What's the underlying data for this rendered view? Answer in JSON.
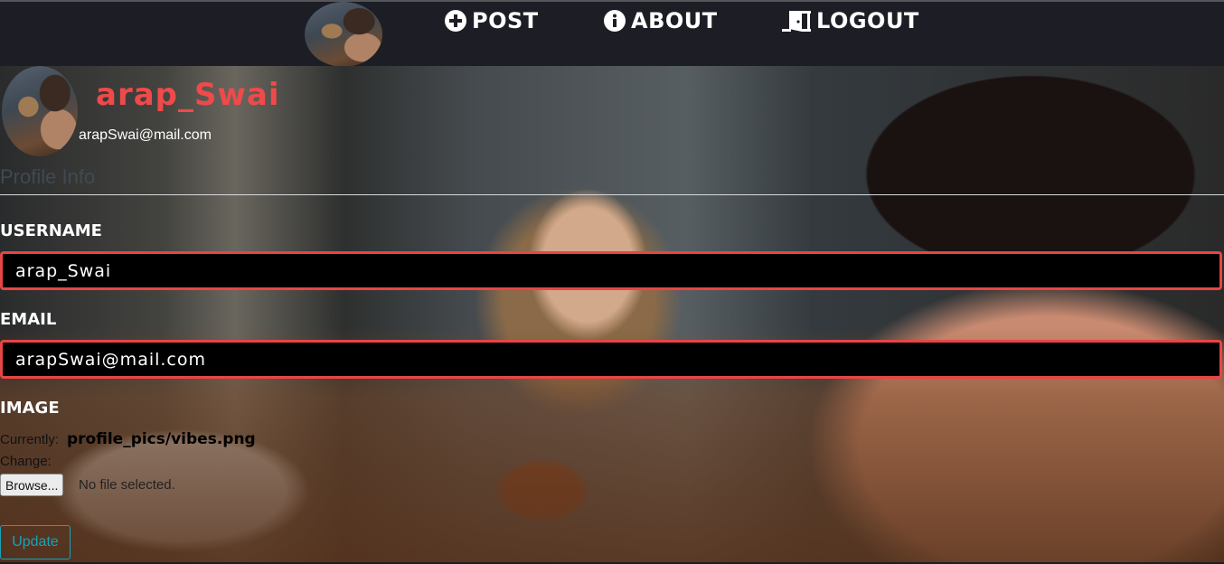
{
  "nav": {
    "post_label": "POST",
    "about_label": "ABOUT",
    "logout_label": "LOGOUT"
  },
  "profile": {
    "username": "arap_Swai",
    "email": "arapSwai@mail.com"
  },
  "form": {
    "legend": "Profile Info",
    "username_label": "USERNAME",
    "username_value": "arap_Swai",
    "email_label": "EMAIL",
    "email_value": "arapSwai@mail.com",
    "image_label": "IMAGE",
    "currently_label": "Currently:",
    "current_file": "profile_pics/vibes.png",
    "change_label": "Change:",
    "browse_label": "Browse...",
    "no_file_label": "No file selected.",
    "submit_label": "Update"
  },
  "colors": {
    "accent": "#e84545",
    "name_color": "#ef4a4a",
    "button_outline": "#17a2b8",
    "navbar_bg": "#1d1e25"
  },
  "icons": {
    "post": "plus-circle-icon",
    "about": "info-circle-icon",
    "logout": "door-open-icon"
  }
}
